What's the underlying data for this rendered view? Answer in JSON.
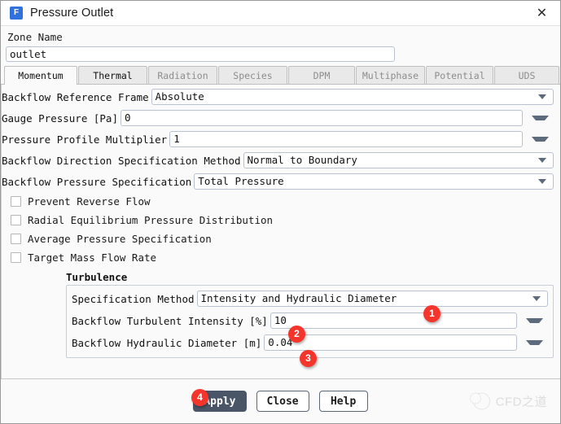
{
  "window": {
    "title": "Pressure Outlet",
    "app_icon": "fluent-f-icon",
    "close_icon": "close-icon",
    "accent_color": "#2f72dd",
    "marker_color": "#f5352b",
    "primary_button_color": "#4a5568"
  },
  "zone": {
    "label": "Zone Name",
    "value": "outlet",
    "placeholder": ""
  },
  "tabs": [
    {
      "label": "Momentum",
      "state": "active"
    },
    {
      "label": "Thermal",
      "state": "enabled"
    },
    {
      "label": "Radiation",
      "state": "disabled"
    },
    {
      "label": "Species",
      "state": "disabled"
    },
    {
      "label": "DPM",
      "state": "disabled"
    },
    {
      "label": "Multiphase",
      "state": "disabled"
    },
    {
      "label": "Potential",
      "state": "disabled"
    },
    {
      "label": "UDS",
      "state": "disabled"
    }
  ],
  "momentum": {
    "rows": [
      {
        "label": "Backflow Reference Frame",
        "value": "Absolute",
        "control": "combobox"
      },
      {
        "label": "Gauge Pressure [Pa]",
        "value": "0",
        "control": "spinner"
      },
      {
        "label": "Pressure Profile Multiplier",
        "value": "1",
        "control": "spinner"
      },
      {
        "label": "Backflow Direction Specification Method",
        "value": "Normal to Boundary",
        "control": "combobox"
      },
      {
        "label": "Backflow Pressure Specification",
        "value": "Total Pressure",
        "control": "combobox"
      }
    ],
    "checkboxes": [
      {
        "label": "Prevent Reverse Flow",
        "checked": false
      },
      {
        "label": "Radial Equilibrium Pressure Distribution",
        "checked": false
      },
      {
        "label": "Average Pressure Specification",
        "checked": false
      },
      {
        "label": "Target Mass Flow Rate",
        "checked": false
      }
    ]
  },
  "turbulence": {
    "title": "Turbulence",
    "rows": [
      {
        "label": "Specification Method",
        "value": "Intensity and Hydraulic Diameter",
        "control": "combobox"
      },
      {
        "label": "Backflow Turbulent Intensity [%]",
        "value": "10",
        "control": "spinner"
      },
      {
        "label": "Backflow Hydraulic Diameter [m]",
        "value": "0.04",
        "control": "spinner"
      }
    ]
  },
  "markers": [
    {
      "number": "1",
      "target": "turbulence-specification-method"
    },
    {
      "number": "2",
      "target": "backflow-turbulent-intensity"
    },
    {
      "number": "3",
      "target": "backflow-hydraulic-diameter"
    },
    {
      "number": "4",
      "target": "apply-button"
    }
  ],
  "footer": {
    "apply_label": "Apply",
    "close_label": "Close",
    "help_label": "Help",
    "watermark_text": "CFD之道",
    "watermark_icon": "wechat-icon"
  }
}
